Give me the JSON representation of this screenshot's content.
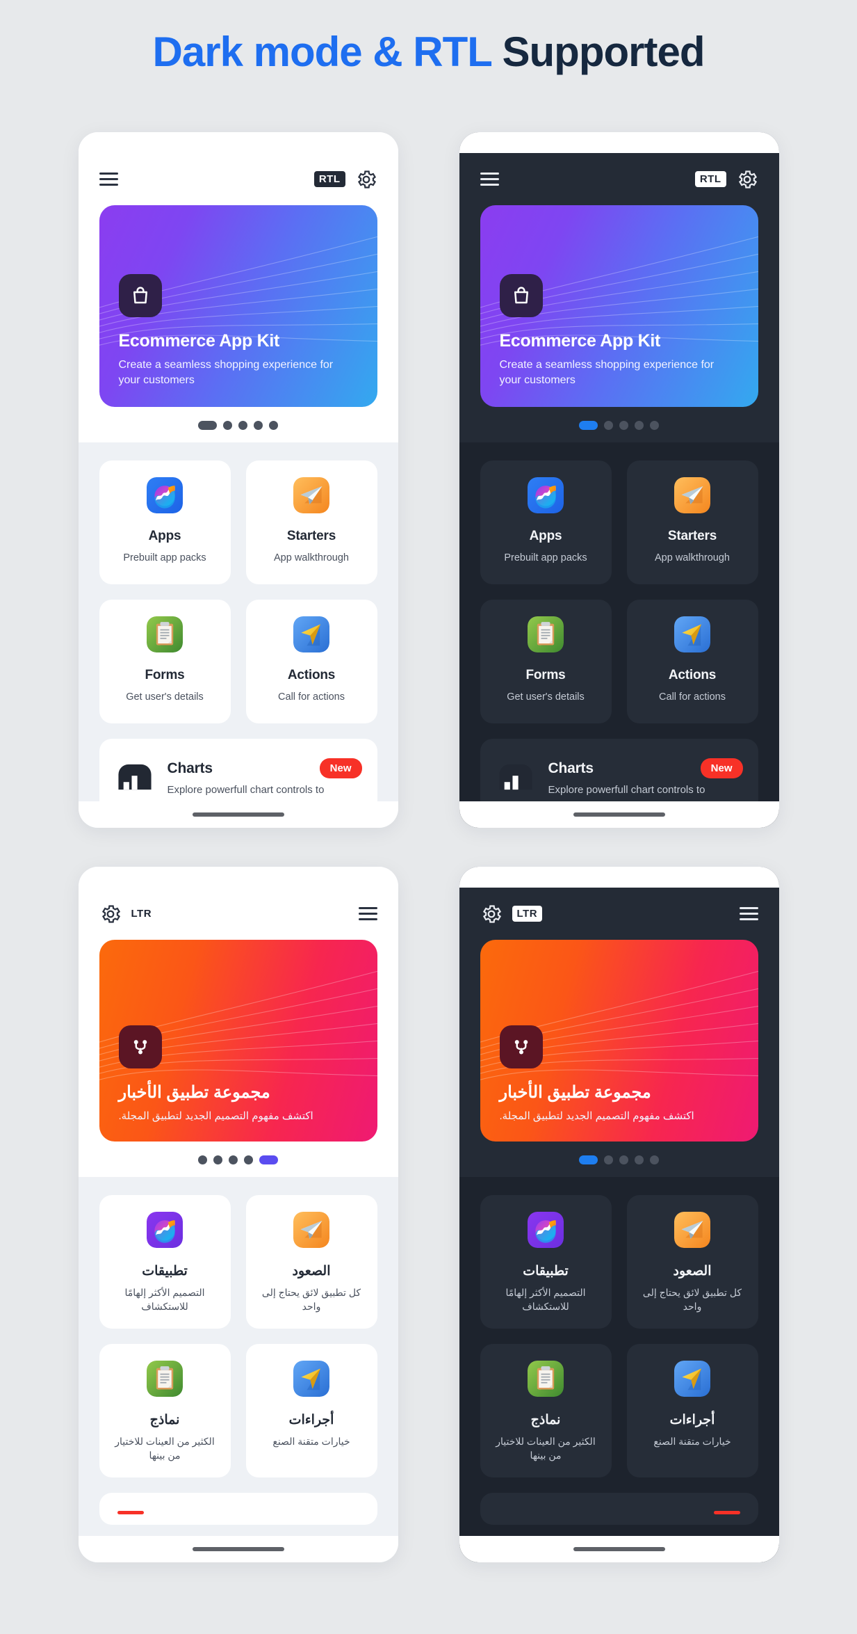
{
  "heading": {
    "accent_part": "Dark mode & RTL",
    "rest_part": " Supported"
  },
  "colors": {
    "accent_blue": "#1e6ef0",
    "heading_dark": "#16283f",
    "page_background": "#e7e9eb",
    "dark_surface": "#1d232d",
    "dark_card": "#262d38",
    "dark_appbar": "#242b36",
    "light_surface": "#eef1f5",
    "badge_red": "#f73127",
    "dot_active_blue": "#1e7ef0",
    "dot_active_purple": "#5a4cf0",
    "banner_blue_from": "#8b3df0",
    "banner_blue_to": "#33a9ef",
    "banner_orange_from": "#fb6a0c",
    "banner_orange_to": "#ef1a72"
  },
  "phones": [
    {
      "id": "light-rtl-english",
      "theme": "light",
      "appbar": {
        "menu_icon": "hamburger-icon",
        "dir_label": "RTL",
        "settings_icon": "gear-icon"
      },
      "banner": {
        "icon": "shopping-bag-icon",
        "title": "Ecommerce App Kit",
        "subtitle": "Create a seamless shopping experience for your customers"
      },
      "dots": {
        "count": 5,
        "active_index": 0,
        "active_color": "blue"
      },
      "tiles": [
        {
          "icon": "apps-logo-icon",
          "title": "Apps",
          "subtitle": "Prebuilt app packs"
        },
        {
          "icon": "paper-plane-icon",
          "title": "Starters",
          "subtitle": "App walkthrough"
        },
        {
          "icon": "clipboard-icon",
          "title": "Forms",
          "subtitle": "Get user's details"
        },
        {
          "icon": "navigation-arrow-icon",
          "title": "Actions",
          "subtitle": "Call for actions"
        }
      ],
      "wide": {
        "icon": "bar-chart-icon",
        "title": "Charts",
        "subtitle": "Explore powerfull chart controls to",
        "badge": "New"
      }
    },
    {
      "id": "dark-rtl-english",
      "theme": "dark",
      "appbar": {
        "menu_icon": "hamburger-icon",
        "dir_label": "RTL",
        "settings_icon": "gear-icon"
      },
      "banner": {
        "icon": "shopping-bag-icon",
        "title": "Ecommerce App Kit",
        "subtitle": "Create a seamless shopping experience for your customers"
      },
      "dots": {
        "count": 5,
        "active_index": 0,
        "active_color": "blue"
      },
      "tiles": [
        {
          "icon": "apps-logo-icon",
          "title": "Apps",
          "subtitle": "Prebuilt app packs"
        },
        {
          "icon": "paper-plane-icon",
          "title": "Starters",
          "subtitle": "App walkthrough"
        },
        {
          "icon": "clipboard-icon",
          "title": "Forms",
          "subtitle": "Get user's details"
        },
        {
          "icon": "navigation-arrow-icon",
          "title": "Actions",
          "subtitle": "Call for actions"
        }
      ],
      "wide": {
        "icon": "bar-chart-icon",
        "title": "Charts",
        "subtitle": "Explore powerfull chart controls to",
        "badge": "New"
      }
    },
    {
      "id": "light-ltr-arabic",
      "theme": "light",
      "appbar": {
        "menu_icon": "hamburger-icon",
        "dir_label": "LTR",
        "settings_icon": "gear-icon"
      },
      "banner": {
        "icon": "git-branch-icon",
        "title": "مجموعة تطبيق الأخبار",
        "subtitle": "اكتشف مفهوم التصميم الجديد لتطبيق المجلة."
      },
      "dots": {
        "count": 5,
        "active_index": 4,
        "active_color": "purple"
      },
      "tiles": [
        {
          "icon": "paper-plane-icon",
          "title": "الصعود",
          "subtitle": "كل تطبيق لائق يحتاج إلى واحد"
        },
        {
          "icon": "apps-logo-purple-icon",
          "title": "تطبيقات",
          "subtitle": "التصميم الأكثر إلهامًا للاستكشاف"
        },
        {
          "icon": "navigation-arrow-icon",
          "title": "أجراءات",
          "subtitle": "خيارات متقنة الصنع"
        },
        {
          "icon": "clipboard-icon",
          "title": "نماذج",
          "subtitle": "الكثير من العينات للاختيار من بينها"
        }
      ],
      "partial_card": {
        "marker": "red-bar"
      }
    },
    {
      "id": "dark-ltr-arabic",
      "theme": "dark",
      "appbar": {
        "menu_icon": "hamburger-icon",
        "dir_label": "LTR",
        "settings_icon": "gear-icon"
      },
      "banner": {
        "icon": "git-branch-icon",
        "title": "مجموعة تطبيق الأخبار",
        "subtitle": "اكتشف مفهوم التصميم الجديد لتطبيق المجلة."
      },
      "dots": {
        "count": 5,
        "active_index": 0,
        "active_color": "blue"
      },
      "tiles": [
        {
          "icon": "paper-plane-icon",
          "title": "الصعود",
          "subtitle": "كل تطبيق لائق يحتاج إلى واحد"
        },
        {
          "icon": "apps-logo-purple-icon",
          "title": "تطبيقات",
          "subtitle": "التصميم الأكثر إلهامًا للاستكشاف"
        },
        {
          "icon": "navigation-arrow-icon",
          "title": "أجراءات",
          "subtitle": "خيارات متقنة الصنع"
        },
        {
          "icon": "clipboard-icon",
          "title": "نماذج",
          "subtitle": "الكثير من العينات للاختيار من بينها"
        }
      ],
      "partial_card": {
        "marker": "red-bar"
      }
    }
  ]
}
